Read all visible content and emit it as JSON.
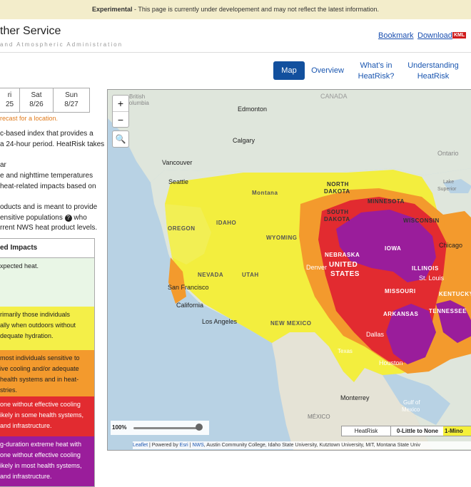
{
  "banner": {
    "label": "Experimental",
    "text": " - This page is currently under developement and may not reflect the latest information."
  },
  "header": {
    "brand": "ther Service",
    "brand_sub": "and Atmospheric Administration",
    "bookmark": "Bookmark",
    "download": "Download",
    "kml": "KML"
  },
  "tabs": {
    "map": "Map",
    "overview": "Overview",
    "whats_in_1": "What's in",
    "whats_in_2": "HeatRisk?",
    "understanding_1": "Understanding",
    "understanding_2": "HeatRisk"
  },
  "days": [
    {
      "name": "ri",
      "date": "25"
    },
    {
      "name": "Sat",
      "date": "8/26"
    },
    {
      "name": "Sun",
      "date": "8/27"
    }
  ],
  "forecast_msg": "recast for a location.",
  "description": [
    "c-based index that provides a",
    "a 24-hour period. HeatRisk takes",
    "ar",
    "e and nighttime temperatures",
    "heat-related impacts based on",
    "oducts and is meant to provide",
    "ensitive populations",
    "rrent NWS heat product levels."
  ],
  "description_who": "who",
  "impacts": {
    "heading": "ed Impacts",
    "levels": [
      {
        "text": "xpected heat.",
        "color": "#e9f6e6"
      },
      {
        "text": "rimarily those individuals|ally when outdoors without|dequate hydration.",
        "color": "#f4ef48"
      },
      {
        "text": "most individuals sensitive to|ive cooling and/or adequate|health systems and in heat-|stries.",
        "color": "#f39a2d"
      },
      {
        "text": "one without effective cooling|ikely in some health systems,|and infrastructure.",
        "color": "#e22b30"
      },
      {
        "text": "g-duration extreme heat with|one without effective cooling|ikely in most health systems,|and infrastructure.",
        "color": "#9a1d9b"
      }
    ]
  },
  "map": {
    "zoom_in": "+",
    "zoom_out": "−",
    "opacity": "100%",
    "legend_title": "HeatRisk",
    "legend_0": "0-Little to None",
    "legend_1": "1-Mino",
    "attribution_leaflet": "Leaflet",
    "attribution_powered": " | Powered by ",
    "attribution_esri": "Esri",
    "attribution_sep": " | ",
    "attribution_nws": "NWS",
    "attribution_rest": ", Austin Community College, Idaho State University, Kutztown University, MIT, Montana State Univ",
    "labels": {
      "british_columbia_1": "British",
      "british_columbia_2": "Columbia",
      "canada": "CANADA",
      "edmonton": "Edmonton",
      "calgary": "Calgary",
      "vancouver": "Vancouver",
      "seattle": "Seattle",
      "ontario": "Ontario",
      "lake_superior_1": "Lake",
      "lake_superior_2": "Superior",
      "north_dakota_1": "NORTH",
      "north_dakota_2": "DAKOTA",
      "south_dakota_1": "SOUTH",
      "south_dakota_2": "DAKOTA",
      "montana": "Montana",
      "minnesota": "MINNESOTA",
      "wisconsin": "WISCONSIN",
      "oregon": "OREGON",
      "idaho": "IDAHO",
      "wyoming": "WYOMING",
      "nebraska": "NEBRASKA",
      "iowa": "IOWA",
      "chicago": "Chicago",
      "nevada": "NEVADA",
      "utah": "UTAH",
      "denver": "Denver",
      "united_states_1": "UNITED",
      "united_states_2": "STATES",
      "illinois": "ILLINOIS",
      "st_louis": "St. Louis",
      "missouri": "MISSOURI",
      "kentucky": "KENTUCKY",
      "san_francisco": "San Francisco",
      "california": "California",
      "los_angeles": "Los Angeles",
      "new_mexico": "NEW MEXICO",
      "arkansas": "ARKANSAS",
      "tennessee": "TENNESSEE",
      "dallas": "Dallas",
      "texas": "Texas",
      "houston": "Houston",
      "monterrey": "Monterrey",
      "mexico": "MÉXICO",
      "gulf_1": "Gulf of",
      "gulf_2": "Mexico"
    }
  }
}
